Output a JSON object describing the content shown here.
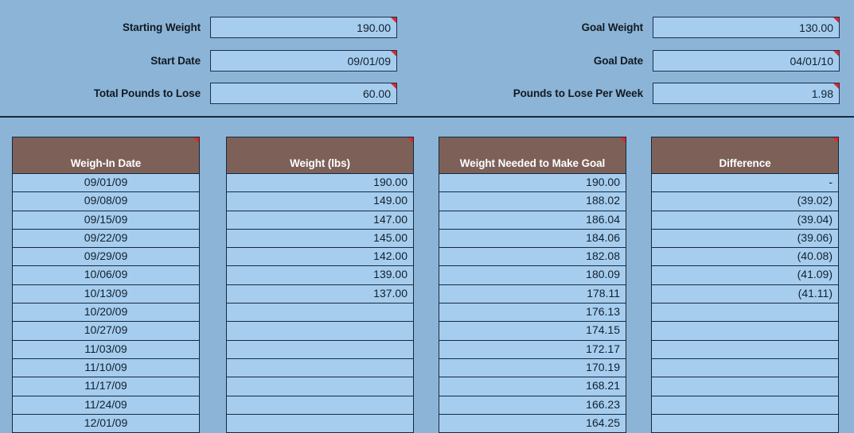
{
  "summary": {
    "fields": [
      {
        "label": "Starting Weight",
        "value": "190.00",
        "col": "left",
        "row": 0
      },
      {
        "label": "Start Date",
        "value": "09/01/09",
        "col": "left",
        "row": 1
      },
      {
        "label": "Total Pounds to Lose",
        "value": "60.00",
        "col": "left",
        "row": 2
      },
      {
        "label": "Goal Weight",
        "value": "130.00",
        "col": "right",
        "row": 0
      },
      {
        "label": "Goal Date",
        "value": "04/01/10",
        "col": "right",
        "row": 1
      },
      {
        "label": "Pounds to Lose Per Week",
        "value": "1.98",
        "col": "right",
        "row": 2
      }
    ]
  },
  "table": {
    "columns": [
      {
        "header": "Weigh-In Date",
        "align": "ctr"
      },
      {
        "header": "Weight (lbs)",
        "align": "rgt"
      },
      {
        "header": "Weight Needed to Make Goal",
        "align": "rgt"
      },
      {
        "header": "Difference",
        "align": "rgt"
      }
    ],
    "rows": [
      {
        "date": "09/01/09",
        "weight": "190.00",
        "needed": "190.00",
        "difference": "-"
      },
      {
        "date": "09/08/09",
        "weight": "149.00",
        "needed": "188.02",
        "difference": "(39.02)"
      },
      {
        "date": "09/15/09",
        "weight": "147.00",
        "needed": "186.04",
        "difference": "(39.04)"
      },
      {
        "date": "09/22/09",
        "weight": "145.00",
        "needed": "184.06",
        "difference": "(39.06)"
      },
      {
        "date": "09/29/09",
        "weight": "142.00",
        "needed": "182.08",
        "difference": "(40.08)"
      },
      {
        "date": "10/06/09",
        "weight": "139.00",
        "needed": "180.09",
        "difference": "(41.09)"
      },
      {
        "date": "10/13/09",
        "weight": "137.00",
        "needed": "178.11",
        "difference": "(41.11)"
      },
      {
        "date": "10/20/09",
        "weight": "",
        "needed": "176.13",
        "difference": ""
      },
      {
        "date": "10/27/09",
        "weight": "",
        "needed": "174.15",
        "difference": ""
      },
      {
        "date": "11/03/09",
        "weight": "",
        "needed": "172.17",
        "difference": ""
      },
      {
        "date": "11/10/09",
        "weight": "",
        "needed": "170.19",
        "difference": ""
      },
      {
        "date": "11/17/09",
        "weight": "",
        "needed": "168.21",
        "difference": ""
      },
      {
        "date": "11/24/09",
        "weight": "",
        "needed": "166.23",
        "difference": ""
      },
      {
        "date": "12/01/09",
        "weight": "",
        "needed": "164.25",
        "difference": ""
      }
    ]
  },
  "colors": {
    "background": "#8cb4d6",
    "cell_fill": "#a6cdee",
    "cell_border": "#16293f",
    "header_fill": "#7d6158",
    "header_text": "#ffffff",
    "comment_flag": "#e0262a"
  }
}
